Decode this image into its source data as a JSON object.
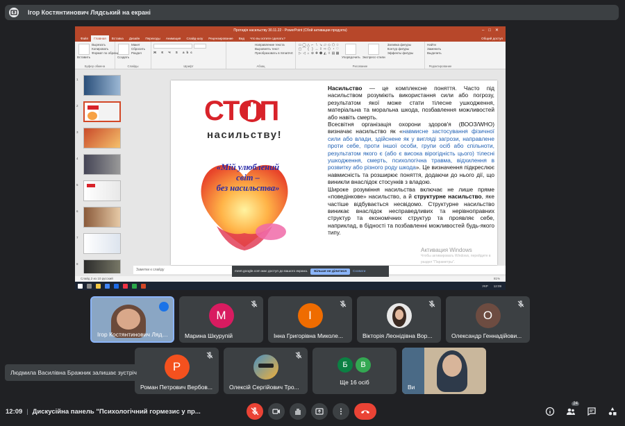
{
  "header": {
    "title": "Ігор Костянтинович Лядський на екрані"
  },
  "ppt": {
    "window_title": "Протидія насильству 30.11.22 - PowerPoint (Сбой активации продукта)",
    "tabs": [
      "Файл",
      "Главная",
      "Вставка",
      "Дизайн",
      "Переходы",
      "Анимация",
      "Слайд-шоу",
      "Рецензирование",
      "Вид",
      "Что вы хотите сделать?"
    ],
    "account": "Общий доступ",
    "groups": [
      "Буфер обмена",
      "Слайды",
      "Шрифт",
      "Абзац",
      "Рисование",
      "Редактирование"
    ],
    "clipboard": {
      "paste": "Вставить",
      "cut": "Вырезать",
      "copy": "Копировать",
      "format": "Формат по образцу"
    },
    "slides": {
      "create": "Создать слайд",
      "layout": "Макет",
      "reset": "Сбросить",
      "section": "Раздел"
    },
    "paragraph": {
      "dir": "Направление текста",
      "align": "Выровнять текст",
      "smartart": "Преобразовать в SmartArt"
    },
    "drawing": {
      "arrange": "Упорядочить",
      "styles": "Экспресс-стили",
      "fill": "Заливка фигуры",
      "outline": "Контур фигуры",
      "effects": "Эффекты фигуры"
    },
    "editing": {
      "find": "Найти",
      "replace": "Заменить",
      "select": "Выделить"
    },
    "notes_placeholder": "Заметки к слайду",
    "status": "Слайд 2 из 10    русский",
    "slide": {
      "stop_word": "СТОП",
      "stop_sub": "насильству!",
      "heart_text": [
        "«Мій улюблений",
        "світ –",
        "без насильства»"
      ],
      "p1_bold": "Насильство",
      "p1": " — це комплексне поняття. Часто під насильством розуміють використання сили або погрозу, результатом якої може стати тілесне ушкодження, матеріальна та моральна шкода, позбавлення можливостей або навіть смерть.",
      "p2_a": " Всесвітня організація охорони здоров'я (ВООЗ/WHO) визначає насильство як «",
      "p2_hl": "навмисне застосування фізичної сили або влади, здійснене як у вигляді загрози, направлене проти себе, проти іншої особи, групи осіб або спільноти, результатом якого є (або є висока вірогідність цього) тілесні ушкодження, смерть, психологічна травма, відхилення в розвитку або різного роду шкода",
      "p2_b": "». Це визначення підкреслює навмисність та розширює поняття, додаючи до нього дії, що виникли внаслідок стосунків з владою.",
      "p3_a": "Широке розуміння насильства включає не лише пряме «поведінкове» насильство, а й ",
      "p3_bold": "структурне насильство",
      "p3_b": ", яке частіше відбувається несвідомо. Структурне насильство виникає внаслідок несправедливих та нерівноправних структур та економічних структур та проявляє себе, наприклад, в бідності та позбавленні можливостей будь-якого типу.",
      "activation": "Активация Windows",
      "activation_sub": "Чтобы активировать Windows, перейдите в раздел \"Параметры\"."
    },
    "tray": {
      "lang": "УКР",
      "time": "12:09",
      "zoom": "81%"
    }
  },
  "share_notice": {
    "text": "meet.google.com має доступ до вашого екрана.",
    "stop": "Більше не ділитися",
    "hide": "Сховати"
  },
  "participants": [
    {
      "name": "Ігор Костянтинович Лядсь...",
      "initial": "",
      "color": "#5b7da8",
      "active": true
    },
    {
      "name": "Марина Шкурупій",
      "initial": "М",
      "color": "#d81b60"
    },
    {
      "name": "Інна Григорівна Миколе...",
      "initial": "І",
      "color": "#ef6c00"
    },
    {
      "name": "Вікторія Леонідівна Вор...",
      "initial": "",
      "color": "#e0e0e0"
    },
    {
      "name": "Олександр Геннадійови...",
      "initial": "О",
      "color": "#6d4c41"
    },
    {
      "name": "Роман Петрович Вербов...",
      "initial": "Р",
      "color": "#f4511e"
    },
    {
      "name": "Олексій Сергійович Тро...",
      "initial": "",
      "color": "#4a90c0"
    },
    {
      "name": "Ще 16 осіб",
      "initial": "",
      "color": ""
    },
    {
      "name": "Ви",
      "initial": "",
      "color": "#7a8fa8"
    }
  ],
  "others_avatars": [
    {
      "letter": "Б",
      "color": "#0b8043"
    },
    {
      "letter": "В",
      "color": "#33a852"
    }
  ],
  "toast": "Людмила Василівна Бражник залишає зустріч",
  "bottom": {
    "time": "12:09",
    "separator": "|",
    "meeting": "Дискусійна панель \"Психологічний гормезис у пр...",
    "participants_count": "24"
  }
}
